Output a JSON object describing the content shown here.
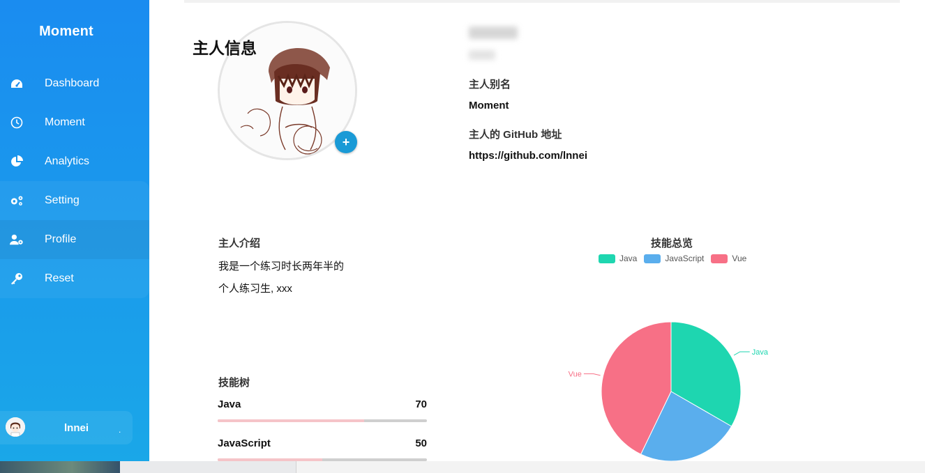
{
  "app": {
    "brand": "Moment"
  },
  "sidebar": {
    "items": [
      {
        "label": "Dashboard",
        "icon": "dashboard-gauge-icon"
      },
      {
        "label": "Moment",
        "icon": "clock-icon"
      },
      {
        "label": "Analytics",
        "icon": "pie-chart-icon"
      },
      {
        "label": "Setting",
        "icon": "gears-icon"
      },
      {
        "label": "Profile",
        "icon": "user-gear-icon"
      },
      {
        "label": "Reset",
        "icon": "key-icon"
      }
    ],
    "user": {
      "name": "lnnei",
      "dot": "."
    }
  },
  "profile": {
    "page_title": "主人信息",
    "alias_label": "主人别名",
    "alias_value": "Moment",
    "github_label": "主人的 GitHub 地址",
    "github_value": "https://github.com/lnnei",
    "avatar_add": "+"
  },
  "intro": {
    "title": "主人介绍",
    "lines": [
      "我是一个练习时长两年半的",
      "个人练习生, xxx"
    ]
  },
  "skills": {
    "title": "技能树",
    "items": [
      {
        "name": "Java",
        "value": 70
      },
      {
        "name": "JavaScript",
        "value": 50
      }
    ]
  },
  "chart_data": {
    "type": "pie",
    "title": "技能总览",
    "labels": [
      "Java",
      "JavaScript",
      "Vue"
    ],
    "values": [
      70,
      50,
      90
    ],
    "colors": [
      "#1ed6b0",
      "#5aaeed",
      "#f77086"
    ],
    "legend": "top"
  }
}
